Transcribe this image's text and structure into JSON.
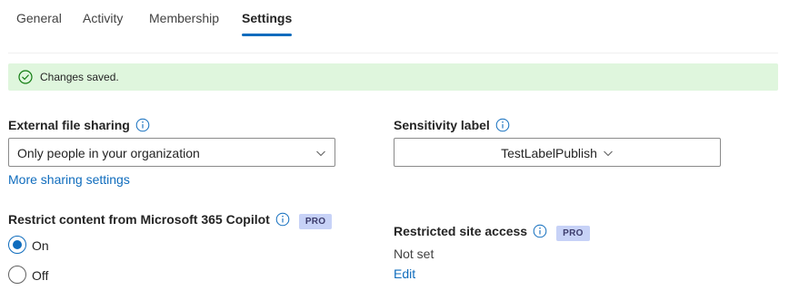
{
  "tabs": [
    {
      "label": "General",
      "active": false
    },
    {
      "label": "Activity",
      "active": false
    },
    {
      "label": "Membership",
      "active": false
    },
    {
      "label": "Settings",
      "active": true
    }
  ],
  "notification": {
    "text": "Changes saved.",
    "icon": "checkmark-circle-icon",
    "color": "#dff6dd"
  },
  "external_sharing": {
    "label": "External file sharing",
    "selected": "Only people in your organization",
    "more_link": "More sharing settings"
  },
  "sensitivity": {
    "label": "Sensitivity label",
    "selected": "TestLabelPublish"
  },
  "copilot": {
    "label": "Restrict content from Microsoft 365 Copilot",
    "badge": "PRO",
    "options": [
      {
        "label": "On",
        "checked": true
      },
      {
        "label": "Off",
        "checked": false
      }
    ]
  },
  "restricted_access": {
    "label": "Restricted site access",
    "badge": "PRO",
    "value": "Not set",
    "edit_link": "Edit"
  },
  "colors": {
    "accent": "#0f6cbd",
    "success_bg": "#dff6dd",
    "pro_badge_bg": "#c7d2f7"
  }
}
